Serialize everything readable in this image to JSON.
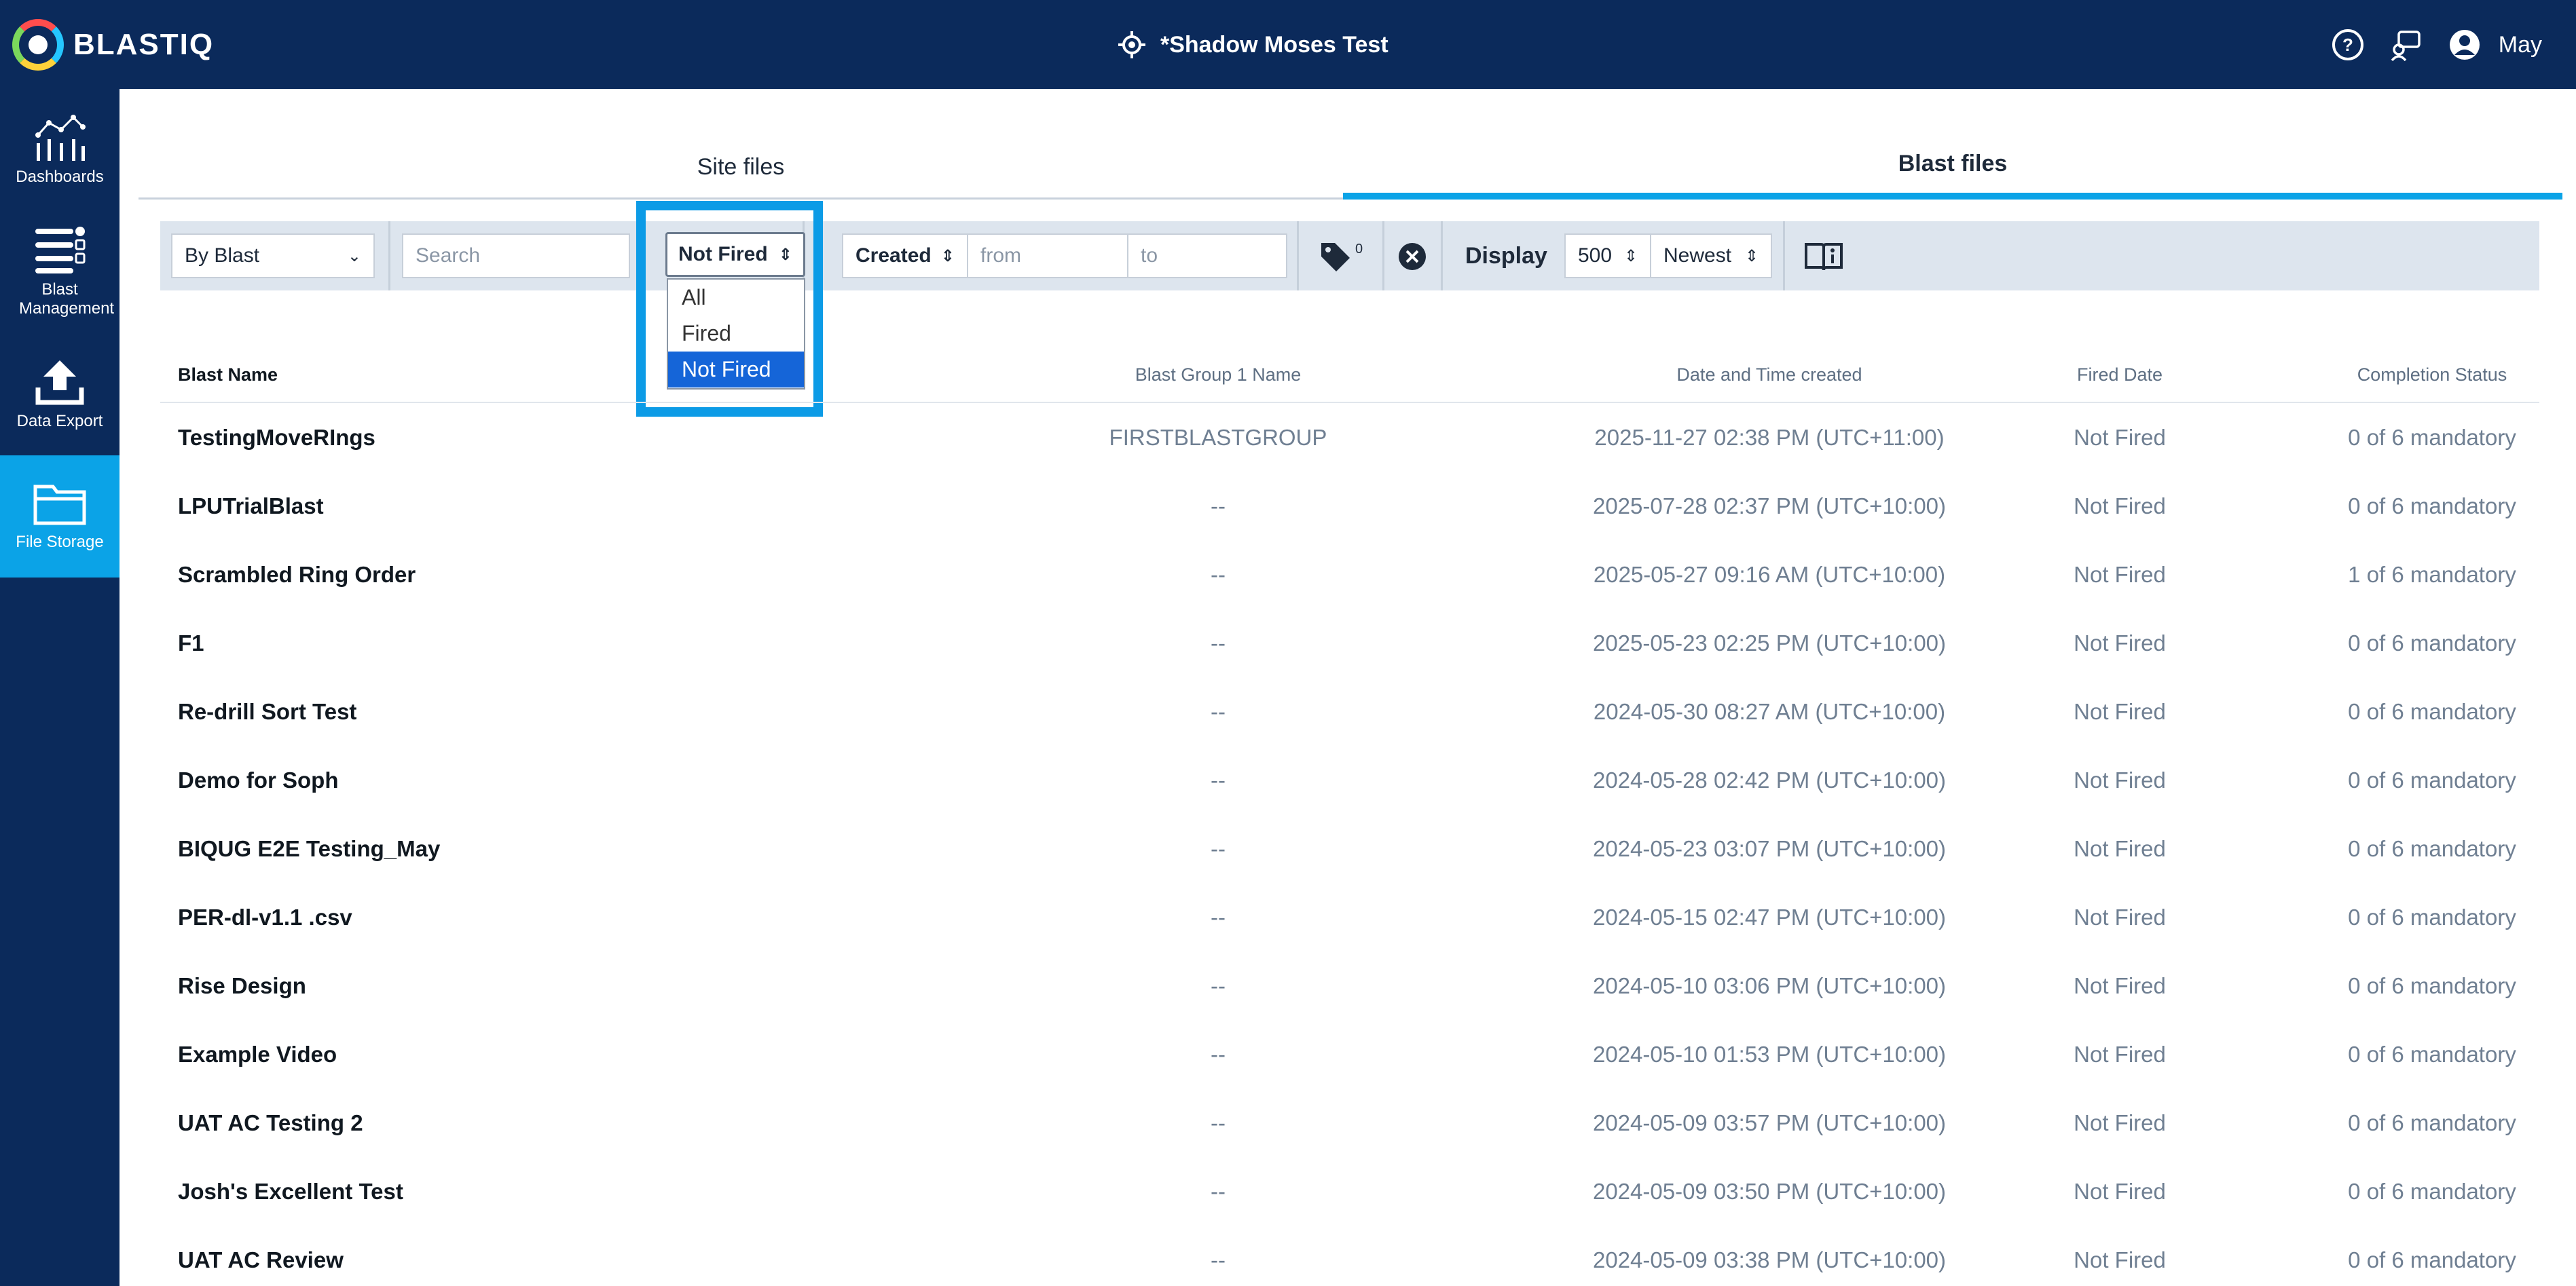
{
  "header": {
    "logo_text": "BLASTIQ",
    "site_title": "*Shadow Moses Test",
    "user_name": "May",
    "icons": [
      "help-icon",
      "support-chat-icon",
      "user-avatar-icon"
    ]
  },
  "sidebar": {
    "items": [
      {
        "label": "Dashboards",
        "icon": "dashboard-chart-icon"
      },
      {
        "label": "Blast Management",
        "icon": "blast-list-icon"
      },
      {
        "label": "Data Export",
        "icon": "upload-icon"
      },
      {
        "label": "File Storage",
        "icon": "folder-icon",
        "active": true
      }
    ]
  },
  "tabs": [
    {
      "label": "Site files",
      "active": false
    },
    {
      "label": "Blast files",
      "active": true
    }
  ],
  "filters": {
    "group_by": "By Blast",
    "search_placeholder": "Search",
    "fired_filter": {
      "selected": "Not Fired",
      "options": [
        "All",
        "Fired",
        "Not Fired"
      ]
    },
    "date_type": "Created",
    "from_placeholder": "from",
    "to_placeholder": "to",
    "tag_count": "0",
    "display_label": "Display",
    "page_size": "500",
    "sort_order": "Newest"
  },
  "table": {
    "columns": [
      "Blast Name",
      "Blast Group 1 Name",
      "Date and Time created",
      "Fired Date",
      "Completion Status"
    ],
    "rows": [
      {
        "name": "TestingMoveRIngs",
        "group": "FIRSTBLASTGROUP",
        "created": "2025-11-27 02:38 PM (UTC+11:00)",
        "fired": "Not Fired",
        "status": "0 of 6 mandatory"
      },
      {
        "name": "LPUTrialBlast",
        "group": "--",
        "created": "2025-07-28 02:37 PM (UTC+10:00)",
        "fired": "Not Fired",
        "status": "0 of 6 mandatory"
      },
      {
        "name": "Scrambled Ring Order",
        "group": "--",
        "created": "2025-05-27 09:16 AM (UTC+10:00)",
        "fired": "Not Fired",
        "status": "1 of 6 mandatory"
      },
      {
        "name": "F1",
        "group": "--",
        "created": "2025-05-23 02:25 PM (UTC+10:00)",
        "fired": "Not Fired",
        "status": "0 of 6 mandatory"
      },
      {
        "name": "Re-drill Sort Test",
        "group": "--",
        "created": "2024-05-30 08:27 AM (UTC+10:00)",
        "fired": "Not Fired",
        "status": "0 of 6 mandatory"
      },
      {
        "name": "Demo for Soph",
        "group": "--",
        "created": "2024-05-28 02:42 PM (UTC+10:00)",
        "fired": "Not Fired",
        "status": "0 of 6 mandatory"
      },
      {
        "name": "BIQUG E2E Testing_May",
        "group": "--",
        "created": "2024-05-23 03:07 PM (UTC+10:00)",
        "fired": "Not Fired",
        "status": "0 of 6 mandatory"
      },
      {
        "name": "PER-dl-v1.1 .csv",
        "group": "--",
        "created": "2024-05-15 02:47 PM (UTC+10:00)",
        "fired": "Not Fired",
        "status": "0 of 6 mandatory"
      },
      {
        "name": "Rise Design",
        "group": "--",
        "created": "2024-05-10 03:06 PM (UTC+10:00)",
        "fired": "Not Fired",
        "status": "0 of 6 mandatory"
      },
      {
        "name": "Example Video",
        "group": "--",
        "created": "2024-05-10 01:53 PM (UTC+10:00)",
        "fired": "Not Fired",
        "status": "0 of 6 mandatory"
      },
      {
        "name": "UAT AC Testing 2",
        "group": "--",
        "created": "2024-05-09 03:57 PM (UTC+10:00)",
        "fired": "Not Fired",
        "status": "0 of 6 mandatory"
      },
      {
        "name": "Josh's Excellent Test",
        "group": "--",
        "created": "2024-05-09 03:50 PM (UTC+10:00)",
        "fired": "Not Fired",
        "status": "0 of 6 mandatory"
      },
      {
        "name": "UAT AC Review",
        "group": "--",
        "created": "2024-05-09 03:38 PM (UTC+10:00)",
        "fired": "Not Fired",
        "status": "0 of 6 mandatory"
      }
    ]
  },
  "colors": {
    "navy": "#0b2a5b",
    "accent": "#0ba3e7",
    "highlight": "#0c9be6",
    "selected_option": "#1565d8"
  }
}
